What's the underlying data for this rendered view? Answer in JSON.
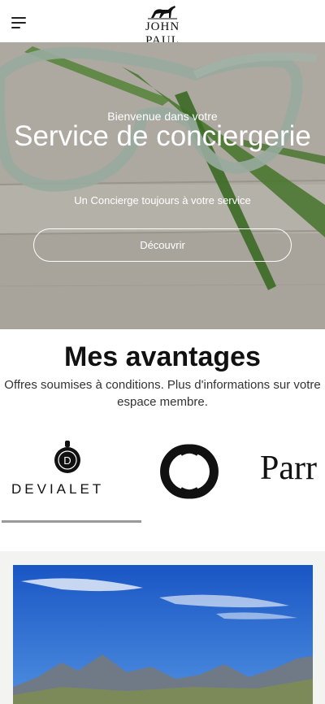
{
  "header": {
    "menu_icon": "hamburger-menu-icon",
    "logo_text": "JOHN PAUL"
  },
  "hero": {
    "kicker": "Bienvenue dans votre",
    "title": "Service de conciergerie",
    "subtitle": "Un Concierge toujours à votre service",
    "button_label": "Découvrir"
  },
  "advantages": {
    "title": "Mes avantages",
    "text": "Offres soumises à conditions. Plus d'informations sur votre espace membre."
  },
  "brands": {
    "items": [
      {
        "name": "DEVIALET",
        "icon": "devialet-logo-icon"
      },
      {
        "name": "CHANEL",
        "icon": "chanel-logo-icon"
      },
      {
        "name": "Parr",
        "icon": "parr-logo-icon"
      }
    ],
    "progress": 0.43
  },
  "colors": {
    "accent_bar": "#999999",
    "section_bg": "#f3f3f2",
    "sky": "#1f5fc8"
  }
}
